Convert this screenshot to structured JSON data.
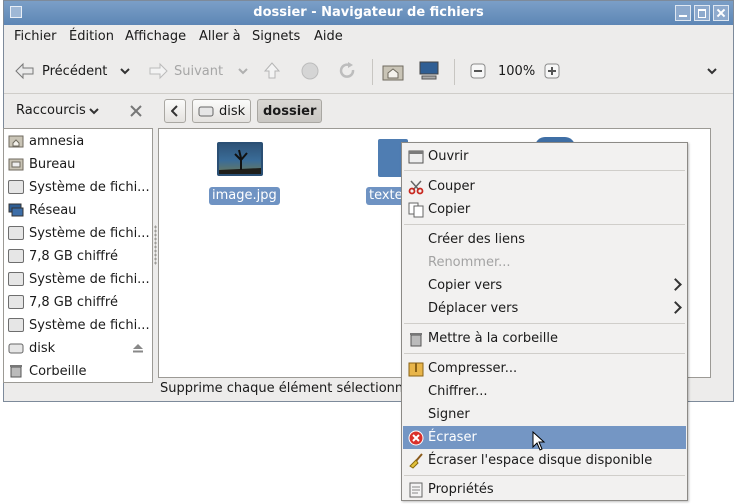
{
  "window": {
    "title": "dossier - Navigateur de fichiers"
  },
  "menu": [
    "Fichier",
    "Édition",
    "Affichage",
    "Aller à",
    "Signets",
    "Aide"
  ],
  "toolbar": {
    "back_label": "Précédent",
    "forward_label": "Suivant",
    "zoom": "100%"
  },
  "pathbar": {
    "places_label": "Raccourcis",
    "crumbs": [
      "disk",
      "dossier"
    ]
  },
  "sidebar": {
    "items": [
      {
        "label": "amnesia",
        "icon": "home-folder-icon"
      },
      {
        "label": "Bureau",
        "icon": "desktop-folder-icon"
      },
      {
        "label": "Système de fichi...",
        "icon": "drive-icon"
      },
      {
        "label": "Réseau",
        "icon": "network-icon"
      },
      {
        "label": "Système de fichi...",
        "icon": "drive-icon"
      },
      {
        "label": "7,8 GB chiffré",
        "icon": "encrypted-drive-icon"
      },
      {
        "label": "Système de fichi...",
        "icon": "drive-icon"
      },
      {
        "label": "7,8 GB chiffré",
        "icon": "encrypted-drive-icon"
      },
      {
        "label": "Système de fichi...",
        "icon": "drive-icon"
      },
      {
        "label": "disk",
        "icon": "removable-disk-icon"
      },
      {
        "label": "Corbeille",
        "icon": "trash-icon"
      }
    ]
  },
  "files": [
    {
      "name": "image.jpg"
    },
    {
      "name": "texte"
    }
  ],
  "statusbar": {
    "text": "Supprime chaque élément sélectionn"
  },
  "context_menu": {
    "items": [
      {
        "label": "Ouvrir",
        "icon": "open-icon"
      },
      {
        "label": "Couper",
        "icon": "scissors-icon"
      },
      {
        "label": "Copier",
        "icon": "copy-icon"
      },
      {
        "label": "Créer des liens",
        "icon": ""
      },
      {
        "label": "Renommer...",
        "icon": "",
        "disabled": true
      },
      {
        "label": "Copier vers",
        "icon": "",
        "submenu": true
      },
      {
        "label": "Déplacer vers",
        "icon": "",
        "submenu": true
      },
      {
        "label": "Mettre à la corbeille",
        "icon": "trash-icon"
      },
      {
        "label": "Compresser...",
        "icon": "archive-icon"
      },
      {
        "label": "Chiffrer...",
        "icon": ""
      },
      {
        "label": "Signer",
        "icon": ""
      },
      {
        "label": "Écraser",
        "icon": "shred-icon",
        "highlight": true
      },
      {
        "label": "Écraser l'espace disque disponible",
        "icon": "broom-icon"
      },
      {
        "label": "Propriétés",
        "icon": "properties-icon"
      }
    ]
  },
  "colors": {
    "titlebar": "#5d86b5",
    "selection": "#7496c4",
    "shred_red": "#d9302b"
  }
}
